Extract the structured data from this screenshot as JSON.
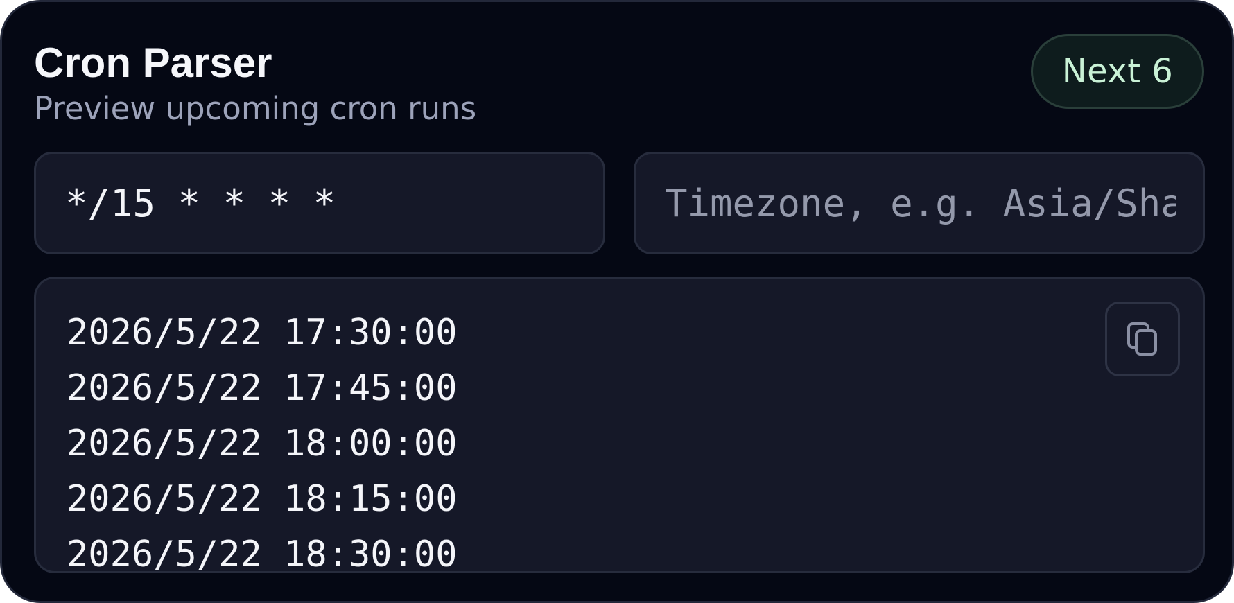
{
  "header": {
    "title": "Cron Parser",
    "subtitle": "Preview upcoming cron runs",
    "badge": "Next 6"
  },
  "inputs": {
    "expression": {
      "value": "*/15 * * * *",
      "placeholder": ""
    },
    "timezone": {
      "value": "",
      "placeholder": "Timezone, e.g. Asia/Shanghai"
    }
  },
  "output": {
    "runs": [
      "2026/5/22 17:30:00",
      "2026/5/22 17:45:00",
      "2026/5/22 18:00:00",
      "2026/5/22 18:15:00",
      "2026/5/22 18:30:00"
    ],
    "copy_icon": "copy-icon"
  },
  "colors": {
    "background": "#050814",
    "panel": "#151828",
    "border": "#272c3d",
    "accent_text": "#c9f2d6",
    "badge_bg": "#0e1c1d",
    "muted_text": "#9da3ba"
  }
}
